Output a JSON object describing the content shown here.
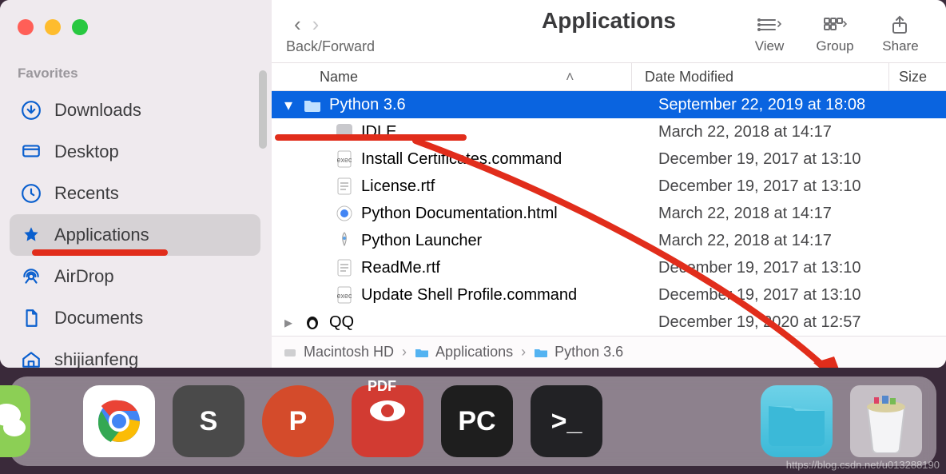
{
  "sidebar": {
    "header": "Favorites",
    "items": [
      {
        "icon": "download",
        "label": "Downloads"
      },
      {
        "icon": "desktop",
        "label": "Desktop"
      },
      {
        "icon": "clock",
        "label": "Recents"
      },
      {
        "icon": "apps",
        "label": "Applications",
        "selected": true
      },
      {
        "icon": "airdrop",
        "label": "AirDrop"
      },
      {
        "icon": "doc",
        "label": "Documents"
      },
      {
        "icon": "home",
        "label": "shijianfeng"
      }
    ]
  },
  "toolbar": {
    "back_forward": "Back/Forward",
    "title": "Applications",
    "groups": [
      {
        "icon": "view",
        "label": "View"
      },
      {
        "icon": "group",
        "label": "Group"
      },
      {
        "icon": "share",
        "label": "Share"
      }
    ]
  },
  "columns": {
    "name": "Name",
    "date": "Date Modified",
    "size": "Size"
  },
  "rows": [
    {
      "indent": 0,
      "expand": "open",
      "icon": "folder",
      "name": "Python 3.6",
      "date": "September 22, 2019 at 18:08",
      "selected": true
    },
    {
      "indent": 1,
      "icon": "app",
      "name": "IDLE",
      "date": "March 22, 2018 at 14:17"
    },
    {
      "indent": 1,
      "icon": "cmd",
      "name": "Install Certificates.command",
      "date": "December 19, 2017 at 13:10"
    },
    {
      "indent": 1,
      "icon": "rtf",
      "name": "License.rtf",
      "date": "December 19, 2017 at 13:10"
    },
    {
      "indent": 1,
      "icon": "html",
      "name": "Python Documentation.html",
      "date": "March 22, 2018 at 14:17"
    },
    {
      "indent": 1,
      "icon": "rocket",
      "name": "Python Launcher",
      "date": "March 22, 2018 at 14:17"
    },
    {
      "indent": 1,
      "icon": "rtf",
      "name": "ReadMe.rtf",
      "date": "December 19, 2017 at 13:10"
    },
    {
      "indent": 1,
      "icon": "cmd",
      "name": "Update Shell Profile.command",
      "date": "December 19, 2017 at 13:10"
    },
    {
      "indent": 0,
      "expand": "closed",
      "icon": "qq",
      "name": "QQ",
      "date": "December 19, 2020 at 12:57"
    }
  ],
  "path": [
    {
      "icon": "disk",
      "label": "Macintosh HD"
    },
    {
      "icon": "folder",
      "label": "Applications"
    },
    {
      "icon": "folder",
      "label": "Python 3.6"
    }
  ],
  "dock": {
    "apps": [
      {
        "id": "wechat",
        "glyph": ""
      },
      {
        "id": "chrome",
        "glyph": ""
      },
      {
        "id": "sublime",
        "glyph": "S"
      },
      {
        "id": "ppt",
        "glyph": "P"
      },
      {
        "id": "pdf",
        "glyph": "PDF"
      },
      {
        "id": "pycharm",
        "glyph": "PC"
      },
      {
        "id": "term",
        "glyph": ">_"
      },
      {
        "id": "spacer",
        "glyph": ""
      },
      {
        "id": "folder",
        "glyph": ""
      },
      {
        "id": "trash",
        "glyph": ""
      }
    ]
  },
  "traffic": {
    "close": "#ff5f57",
    "min": "#febc2e",
    "max": "#28c840"
  },
  "watermark": "https://blog.csdn.net/u013288190"
}
